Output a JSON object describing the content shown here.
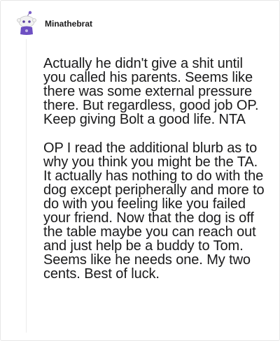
{
  "comment": {
    "username": "Minathebrat",
    "avatar_icon": "snoo-avatar-icon",
    "paragraphs": [
      "Actually he didn't give a shit until you called his parents. Seems like there was some external pressure there. But regardless, good job OP. Keep giving Bolt a good life. NTA",
      "OP I read the additional blurb as to why you think you might be the TA. It actually has nothing to do with the dog except peripherally and more to do with you feeling like you failed your friend. Now that the dog is off the table maybe you can reach out and just help be a buddy to Tom. Seems like he needs one. My two cents. Best of luck."
    ]
  }
}
